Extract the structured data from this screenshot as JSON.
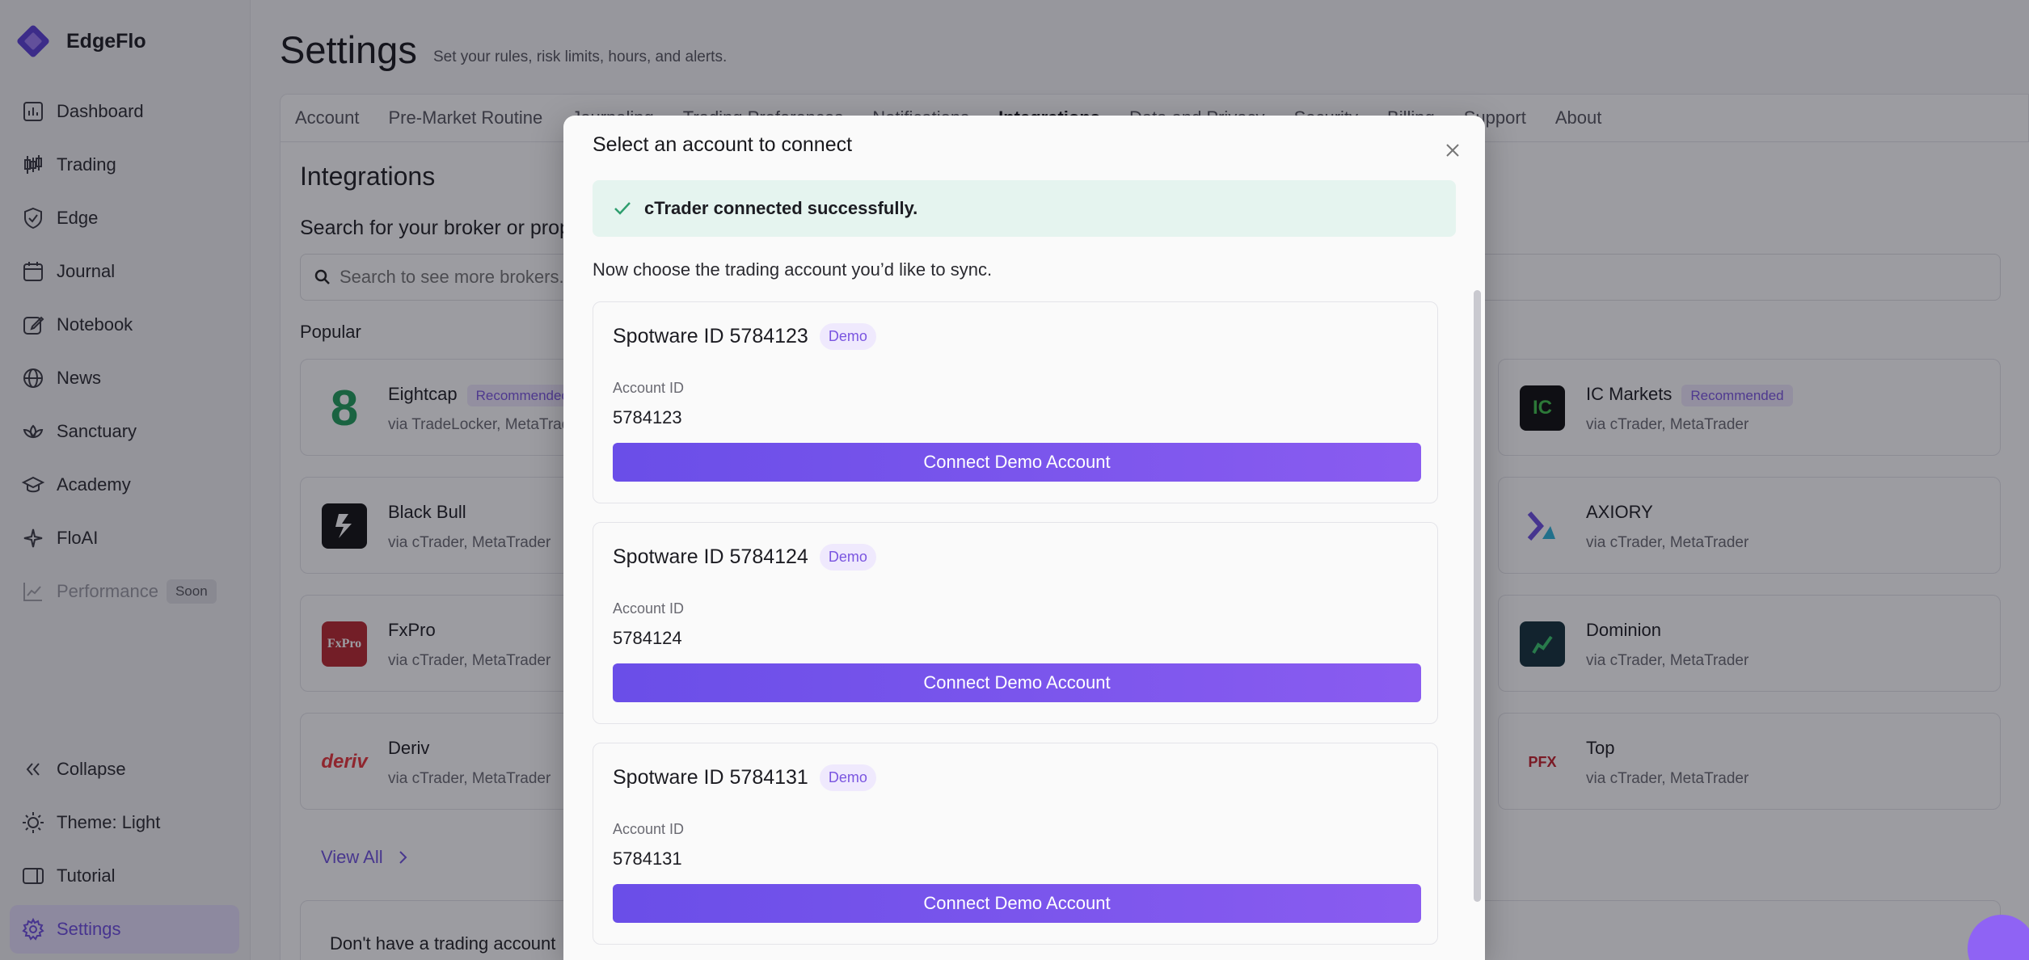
{
  "brand": {
    "name": "EdgeFlo"
  },
  "sidebar": {
    "items": [
      {
        "label": "Dashboard",
        "icon": "dashboard-icon"
      },
      {
        "label": "Trading",
        "icon": "candlestick-icon"
      },
      {
        "label": "Edge",
        "icon": "shield-check-icon"
      },
      {
        "label": "Journal",
        "icon": "calendar-icon"
      },
      {
        "label": "Notebook",
        "icon": "edit-icon"
      },
      {
        "label": "News",
        "icon": "globe-icon"
      },
      {
        "label": "Sanctuary",
        "icon": "lotus-icon"
      },
      {
        "label": "Academy",
        "icon": "graduation-cap-icon"
      },
      {
        "label": "FloAI",
        "icon": "sparkle-icon"
      },
      {
        "label": "Performance",
        "icon": "chart-line-icon",
        "badge": "Soon"
      }
    ],
    "bottom": [
      {
        "label": "Collapse",
        "icon": "double-chevron-left-icon"
      },
      {
        "label": "Theme: Light",
        "icon": "sun-icon"
      },
      {
        "label": "Tutorial",
        "icon": "video-icon"
      },
      {
        "label": "Settings",
        "icon": "gear-icon"
      }
    ]
  },
  "header": {
    "title": "Settings",
    "subtitle": "Set your rules, risk limits, hours, and alerts."
  },
  "tabs": [
    "Account",
    "Pre-Market Routine",
    "Journaling",
    "Trading Preferences",
    "Notifications",
    "Integrations",
    "Data and Privacy",
    "Security",
    "Billing",
    "Support",
    "About"
  ],
  "integrations": {
    "title": "Integrations",
    "search_label": "Search for your broker or prop firm",
    "search_placeholder": "Search to see more brokers...",
    "popular_label": "Popular",
    "brokers": [
      {
        "name": "Eightcap",
        "via": "via TradeLocker, MetaTrader",
        "badge": "Recommended",
        "logo_text": "8"
      },
      {
        "name": "Black Bull",
        "via": "via cTrader, MetaTrader",
        "logo_text": ""
      },
      {
        "name": "FxPro",
        "via": "via cTrader, MetaTrader",
        "logo_text": "FxPro"
      },
      {
        "name": "Deriv",
        "via": "via cTrader, MetaTrader",
        "logo_text": "deriv"
      },
      {
        "name": "IC Markets",
        "via": "via cTrader, MetaTrader",
        "badge": "Recommended",
        "logo_text": "IC"
      },
      {
        "name": "AXIORY",
        "via": "via cTrader, MetaTrader",
        "logo_text": ""
      },
      {
        "name": "Dominion",
        "via": "via cTrader, MetaTrader",
        "logo_text": ""
      },
      {
        "name": "Top",
        "via": "via cTrader, MetaTrader",
        "logo_text": "PFX"
      }
    ],
    "view_all": "View All",
    "no_account": "Don't have a trading account"
  },
  "modal": {
    "title": "Select an account to connect",
    "success": "cTrader connected successfully.",
    "instruction": "Now choose the trading account you’d like to sync.",
    "account_id_label": "Account ID",
    "accounts": [
      {
        "name": "Spotware ID 5784123",
        "badge": "Demo",
        "id": "5784123",
        "button": "Connect Demo Account"
      },
      {
        "name": "Spotware ID 5784124",
        "badge": "Demo",
        "id": "5784124",
        "button": "Connect Demo Account"
      },
      {
        "name": "Spotware ID 5784131",
        "badge": "Demo",
        "id": "5784131",
        "button": "Connect Demo Account"
      }
    ]
  },
  "colors": {
    "accent": "#6f52df",
    "success_bg": "#e5f4ef",
    "success_check": "#2e9e6e"
  }
}
